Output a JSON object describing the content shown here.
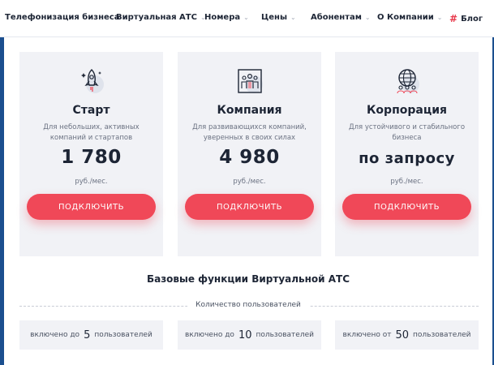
{
  "nav": {
    "items": [
      {
        "label": "Телефонизация бизнеса",
        "chevron": "chevron-down-icon"
      },
      {
        "label": "Виртуальная АТС",
        "chevron": "chevron-down-icon"
      },
      {
        "label": "Номера",
        "chevron": "chevron-down-icon"
      },
      {
        "label": "Цены",
        "chevron": "chevron-down-icon"
      },
      {
        "label": "Абонентам",
        "chevron": "chevron-down-icon"
      },
      {
        "label": "О Компании",
        "chevron": "chevron-down-icon"
      }
    ],
    "blog": {
      "hash": "#",
      "label": "Блог"
    }
  },
  "plans": [
    {
      "icon": "rocket-icon",
      "title": "Старт",
      "description": "Для небольших, активных компаний и стартапов",
      "price": "1 780",
      "unit": "руб./мес.",
      "button": "ПОДКЛЮЧИТЬ"
    },
    {
      "icon": "team-icon",
      "title": "Компания",
      "description": "Для развивающихся компаний, уверенных в своих силах",
      "price": "4 980",
      "unit": "руб./мес.",
      "button": "ПОДКЛЮЧИТЬ"
    },
    {
      "icon": "globe-people-icon",
      "title": "Корпорация",
      "description": "Для устойчивого и стабильного бизнеса",
      "price": "по запросу",
      "unit": "руб./мес.",
      "button": "ПОДКЛЮЧИТЬ"
    }
  ],
  "features": {
    "title": "Базовые функции Виртуальной АТС",
    "users_heading": "Количество пользователей",
    "users": [
      {
        "prefix": "включено до",
        "count": "5",
        "suffix": "пользователей"
      },
      {
        "prefix": "включено до",
        "count": "10",
        "suffix": "пользователей"
      },
      {
        "prefix": "включено от",
        "count": "50",
        "suffix": "пользователей"
      }
    ]
  },
  "colors": {
    "accent": "#f04858",
    "brand_blue": "#1b4f8f",
    "card_bg": "#f1f2f6",
    "text_dark": "#1d2535"
  }
}
